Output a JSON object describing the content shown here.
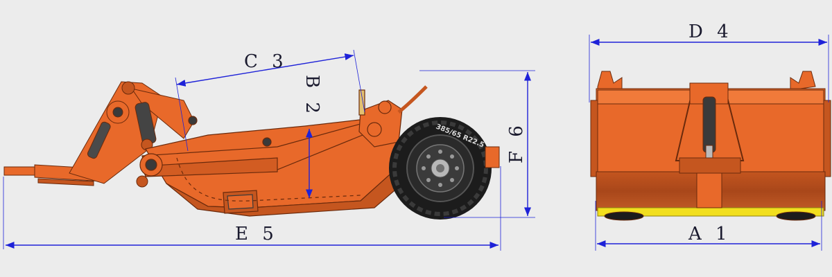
{
  "dimensions": {
    "a1": "A 1",
    "b2": "B 2",
    "c3": "C 3",
    "d4": "D 4",
    "e5": "E 5",
    "f6": "F 6"
  },
  "tire_marking": "385/65 R22.5",
  "colors": {
    "body_orange": "#e8692a",
    "body_dark": "#b84a17",
    "dimension_blue": "#1e22d8",
    "tire": "#1c1c1c",
    "blade_yellow": "#f2df1e",
    "background": "#ececec"
  }
}
